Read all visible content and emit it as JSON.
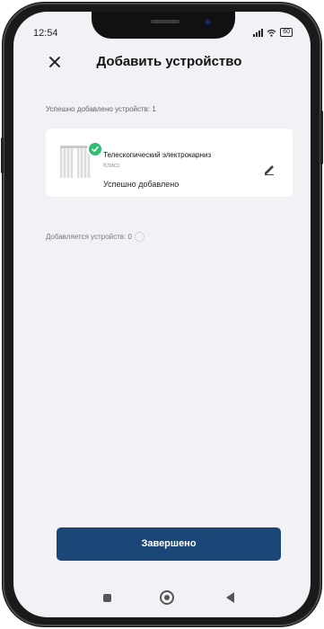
{
  "status_bar": {
    "time": "12:54",
    "battery": "60"
  },
  "header": {
    "title": "Добавить устройство"
  },
  "main": {
    "success_count_label": "Успешно добавлено устройств: 1",
    "device": {
      "name": "Телескопический электрокарниз",
      "class": "Класс",
      "status": "Успешно добавлено"
    },
    "adding_count_label": "Добавляется устройств: 0"
  },
  "footer": {
    "done_label": "Завершено"
  },
  "colors": {
    "primary_button": "#1b4778",
    "success_badge": "#2fbf71",
    "screen_background": "#f2f2f6"
  },
  "icons": [
    "close-icon",
    "check-icon",
    "curtain-icon",
    "edit-pencil-icon",
    "loading-spinner-icon",
    "wifi-icon",
    "signal-icon",
    "battery-icon",
    "nav-recent-icon",
    "nav-home-icon",
    "nav-back-icon"
  ]
}
